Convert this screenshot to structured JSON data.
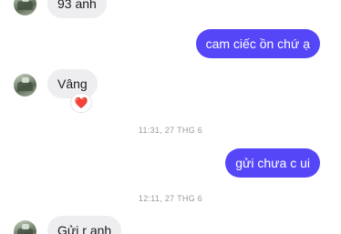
{
  "messages": [
    {
      "id": "m1",
      "direction": "incoming",
      "text": "93 anh"
    },
    {
      "id": "m2",
      "direction": "outgoing",
      "text": "cam ciếc ồn chứ ạ"
    },
    {
      "id": "m3",
      "direction": "incoming",
      "text": "Vâng",
      "reaction": "❤️"
    },
    {
      "id": "ts1",
      "type": "timestamp",
      "text": "11:31, 27 THG 6"
    },
    {
      "id": "m4",
      "direction": "outgoing",
      "text": "gửi chưa c ui"
    },
    {
      "id": "ts2",
      "type": "timestamp",
      "text": "12:11, 27 THG 6"
    },
    {
      "id": "m5",
      "direction": "incoming",
      "text": "Gửi r anh"
    }
  ],
  "colors": {
    "outgoing_bubble": "#5547f7",
    "incoming_bubble": "#eeeef0",
    "timestamp_text": "#9a9aa0"
  }
}
